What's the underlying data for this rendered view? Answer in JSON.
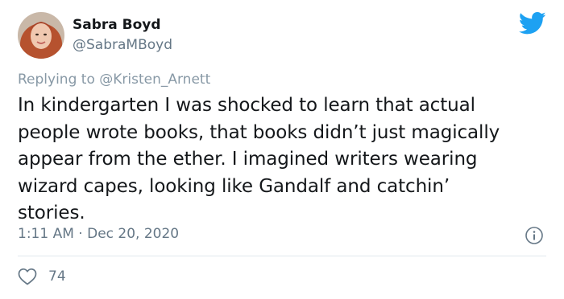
{
  "author": {
    "name": "Sabra Boyd",
    "handle": "@SabraMBoyd"
  },
  "reply": {
    "prefix": "Replying to",
    "handle": "@Kristen_Arnett"
  },
  "tweet": {
    "line1": "In kindergarten I was shocked to learn that actual",
    "line2": "people wrote books, that books didn’t just magically",
    "line3": "appear from the ether. I imagined writers wearing",
    "line4": "wizard capes, looking like Gandalf and catchin’",
    "line5": "stories."
  },
  "meta": {
    "time": "1:11 AM",
    "separator": "·",
    "date": "Dec 20, 2020"
  },
  "stats": {
    "likes": "74"
  },
  "icons": {
    "logo": "twitter-bird-icon",
    "info": "info-icon",
    "like": "heart-icon"
  },
  "colors": {
    "brand": "#1da1f2",
    "secondary_text": "#657786",
    "primary_text": "#14171a",
    "divider": "#e1e8ed"
  }
}
